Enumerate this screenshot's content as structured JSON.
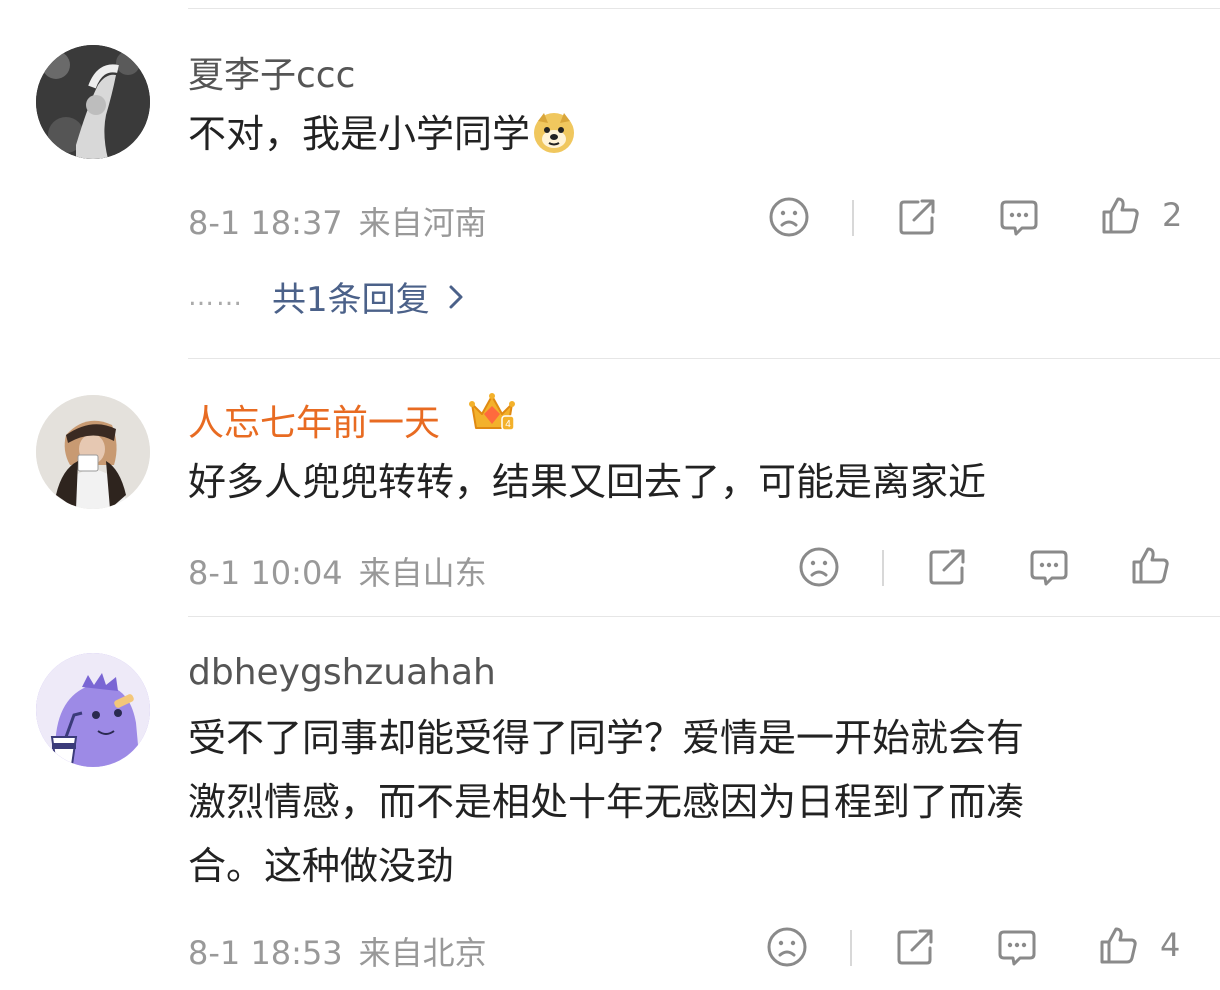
{
  "comments": [
    {
      "username": "夏李子ccc",
      "text": "不对，我是小学同学",
      "emoji_icon": "doge-icon",
      "time": "8-1 18:37",
      "location": "来自河南",
      "likes": "2",
      "reply_summary": "共1条回复",
      "dots": "……"
    },
    {
      "username": "人忘七年前一天",
      "badge_icon": "crown-vip-icon",
      "text": "好多人兜兜转转，结果又回去了，可能是离家近",
      "time": "8-1 10:04",
      "location": "来自山东",
      "likes": ""
    },
    {
      "username": "dbheygshzuahah",
      "text": "受不了同事却能受得了同学？爱情是一开始就会有\n激烈情感，而不是相处十年无感因为日程到了而凑\n合。这种做没劲",
      "time": "8-1 18:53",
      "location": "来自北京",
      "likes": "4"
    }
  ],
  "colors": {
    "vip_name": "#e86b22",
    "reply_link": "#4b6189",
    "meta": "#999999"
  }
}
